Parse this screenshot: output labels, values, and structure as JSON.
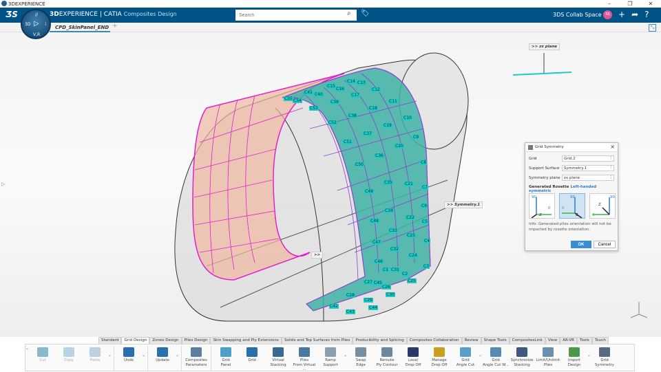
{
  "window": {
    "title": "3DEXPERIENCE",
    "controls": [
      "–",
      "❐",
      "✕"
    ]
  },
  "header": {
    "brand_bold": "3D",
    "brand_rest": "EXPERIENCE | CATIA",
    "app": "Composites Design",
    "search_placeholder": "Search",
    "collab_space": "3DS Collab Space ⌄",
    "avatar": "SS",
    "compass": {
      "top": "//",
      "left": "3D",
      "right": "i",
      "bottom": "V,R"
    }
  },
  "tabs": {
    "document": "CPD_SkinPanel_END A",
    "add": "+"
  },
  "viewport": {
    "zx_plane_tag": ">> zx plane",
    "symmetry_tag": ">> Symmetry.1",
    "grid_tag": ">>",
    "ply_labels": [
      "C14",
      "C13",
      "C15",
      "C16",
      "C12",
      "C41",
      "C40",
      "C17",
      "C54",
      "C55",
      "C39",
      "C11",
      "C53",
      "C18",
      "C10",
      "C38",
      "C52",
      "C19",
      "C37",
      "C9",
      "C51",
      "C20",
      "C36",
      "C50",
      "C8",
      "C35",
      "C21",
      "C49",
      "C7",
      "C6",
      "C34",
      "C48",
      "C22",
      "C5",
      "C33",
      "C23",
      "C47",
      "C4",
      "C32",
      "C24",
      "C46",
      "C3",
      "C1",
      "C31",
      "C2",
      "C25",
      "C27",
      "C45",
      "C26",
      "C30",
      "C28",
      "C29",
      "C42",
      "C44",
      "C43"
    ],
    "colors": {
      "teal_surface": "#3fb3a6",
      "magenta_grid": "#e020d0",
      "purple_grid": "#8a3fd0"
    }
  },
  "dialog": {
    "title": "Grid Symmetry",
    "fields": [
      {
        "label": "Grid",
        "value": "Grid.2"
      },
      {
        "label": "Support Surface",
        "value": "Symmetry.1"
      },
      {
        "label": "Symmetry plane",
        "value": "zx plane"
      }
    ],
    "generated_label": "Generated Rosette",
    "generated_value": "Left-handed symmetric",
    "rosettes": [
      {
        "y": "90",
        "x": "0",
        "z": "Z"
      },
      {
        "y": "90",
        "x": "0",
        "z": "Z"
      },
      {
        "y": "90",
        "x": "0",
        "z": "Z"
      }
    ],
    "selected_rosette": 1,
    "info": "Info: Generated plies orientation will not be impacted by rosette orientation.",
    "ok": "OK",
    "cancel": "Cancel"
  },
  "ribbon": {
    "tabs": [
      "Standard",
      "Grid Design",
      "Zones Design",
      "Plies Design",
      "Skin Swapping and Ply Extensions",
      "Solids and Top Surfaces from Plies",
      "Producibility and Splicing",
      "Composites Collaboration",
      "Review",
      "Shape Tools",
      "CompositesLink",
      "View",
      "AR-VR",
      "Tools",
      "Touch"
    ],
    "active_tab": 1,
    "commands": [
      {
        "l1": "Cut",
        "l2": ""
      },
      {
        "l1": "Copy",
        "l2": ""
      },
      {
        "l1": "Paste",
        "l2": ""
      },
      {
        "l1": "Undo",
        "l2": ""
      },
      {
        "l1": "Update",
        "l2": ""
      },
      {
        "l1": "Composites",
        "l2": "Parameters"
      },
      {
        "l1": "Grid",
        "l2": "Panel"
      },
      {
        "l1": "Grid",
        "l2": ""
      },
      {
        "l1": "Virtual",
        "l2": "Stacking"
      },
      {
        "l1": "Plies",
        "l2": "From Virtual ..."
      },
      {
        "l1": "Ramp",
        "l2": "Support"
      },
      {
        "l1": "Swap",
        "l2": "Edge"
      },
      {
        "l1": "Reroute",
        "l2": "Ply Contour"
      },
      {
        "l1": "Local",
        "l2": "Drop Off"
      },
      {
        "l1": "Manage",
        "l2": "Drop Off"
      },
      {
        "l1": "Grid",
        "l2": "Angle Cut"
      },
      {
        "l1": "Grid",
        "l2": "Angle Cut W..."
      },
      {
        "l1": "Synchronize",
        "l2": "Stacking"
      },
      {
        "l1": "Limit/Unlimit",
        "l2": "Plies"
      },
      {
        "l1": "Import",
        "l2": "Design"
      },
      {
        "l1": "Grid",
        "l2": "Symmetry"
      }
    ]
  }
}
